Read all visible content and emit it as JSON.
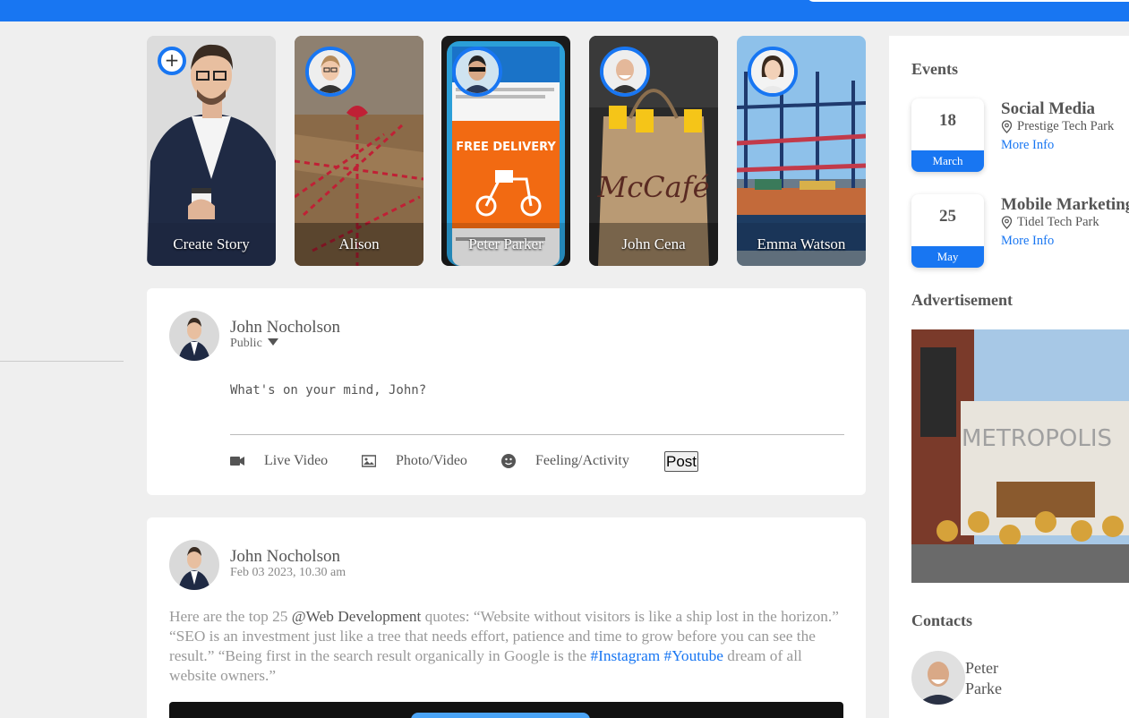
{
  "stories": [
    {
      "name": "Create Story",
      "icon": "plus-icon"
    },
    {
      "name": "Alison"
    },
    {
      "name": "Peter Parker"
    },
    {
      "name": "John Cena"
    },
    {
      "name": "Emma Watson"
    }
  ],
  "composer": {
    "user": "John Nocholson",
    "privacy": "Public",
    "placeholder": "What's on your mind, John?",
    "actions": [
      "Live Video",
      "Photo/Video",
      "Feeling/Activity"
    ],
    "post_label": "Post"
  },
  "post": {
    "user": "John Nocholson",
    "time": "Feb 03 2023, 10.30 am",
    "text_before": "Here are the top 25 ",
    "mention": "@Web Development",
    "text_middle": " quotes: “Website without visitors is like a ship lost in the horizon.” “SEO is an investment just like a tree that needs effort, patience and time to grow before you can see the result.” “Being first in the search result organically in Google is the ",
    "tag1": "#Instagram",
    "tag2": "#Youtube",
    "text_after": " dream of all website owners.”"
  },
  "sidebar": {
    "events_title": "Events",
    "events": [
      {
        "day": "18",
        "month": "March",
        "title": "Social Media",
        "place": "Prestige Tech Park",
        "more": "More Info"
      },
      {
        "day": "25",
        "month": "May",
        "title": "Mobile Marketing",
        "place": "Tidel Tech Park",
        "more": "More Info"
      }
    ],
    "ad_title": "Advertisement",
    "contacts_title": "Contacts",
    "contact_name": "Peter Parke"
  },
  "colors": {
    "accent": "#1876f2",
    "background": "#efefef"
  }
}
